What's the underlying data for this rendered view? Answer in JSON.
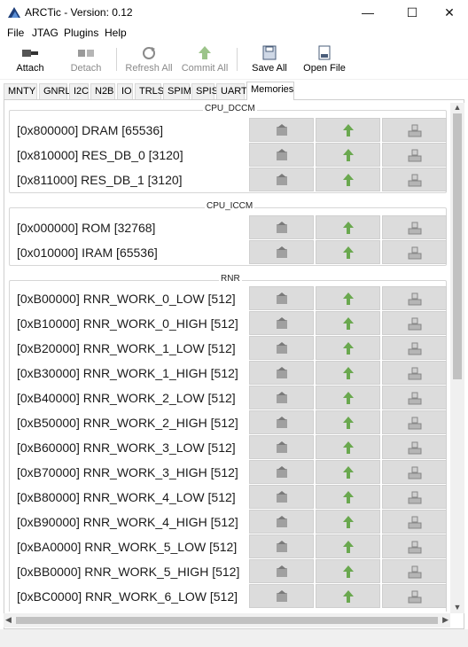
{
  "window": {
    "title": "ARCTic - Version: 0.12"
  },
  "menu": [
    "File",
    "JTAG",
    "Plugins",
    "Help"
  ],
  "toolbar": {
    "attach": "Attach",
    "detach": "Detach",
    "refresh_all": "Refresh All",
    "commit_all": "Commit All",
    "save_all": "Save All",
    "open_file": "Open File"
  },
  "tabs": [
    "MNTY",
    "GNRL",
    "I2C",
    "N2B",
    "IO",
    "TRLS",
    "SPIM",
    "SPIS",
    "UART",
    "Memories"
  ],
  "active_tab": "Memories",
  "groups": [
    {
      "title": "CPU_DCCM",
      "rows": [
        "[0x800000] DRAM [65536]",
        "[0x810000] RES_DB_0 [3120]",
        "[0x811000] RES_DB_1 [3120]"
      ]
    },
    {
      "title": "CPU_ICCM",
      "rows": [
        "[0x000000] ROM [32768]",
        "[0x010000] IRAM [65536]"
      ]
    },
    {
      "title": "RNR",
      "rows": [
        "[0xB00000] RNR_WORK_0_LOW [512]",
        "[0xB10000] RNR_WORK_0_HIGH [512]",
        "[0xB20000] RNR_WORK_1_LOW [512]",
        "[0xB30000] RNR_WORK_1_HIGH [512]",
        "[0xB40000] RNR_WORK_2_LOW [512]",
        "[0xB50000] RNR_WORK_2_HIGH [512]",
        "[0xB60000] RNR_WORK_3_LOW [512]",
        "[0xB70000] RNR_WORK_3_HIGH [512]",
        "[0xB80000] RNR_WORK_4_LOW [512]",
        "[0xB90000] RNR_WORK_4_HIGH [512]",
        "[0xBA0000] RNR_WORK_5_LOW [512]",
        "[0xBB0000] RNR_WORK_5_HIGH [512]",
        "[0xBC0000] RNR_WORK_6_LOW [512]"
      ]
    }
  ],
  "icons": {
    "refresh": "refresh-icon",
    "commit": "commit-up-arrow-icon",
    "save": "save-drive-icon"
  },
  "colors": {
    "cell_bg": "#dcdcdc",
    "arrow_green": "#6aa84f"
  }
}
